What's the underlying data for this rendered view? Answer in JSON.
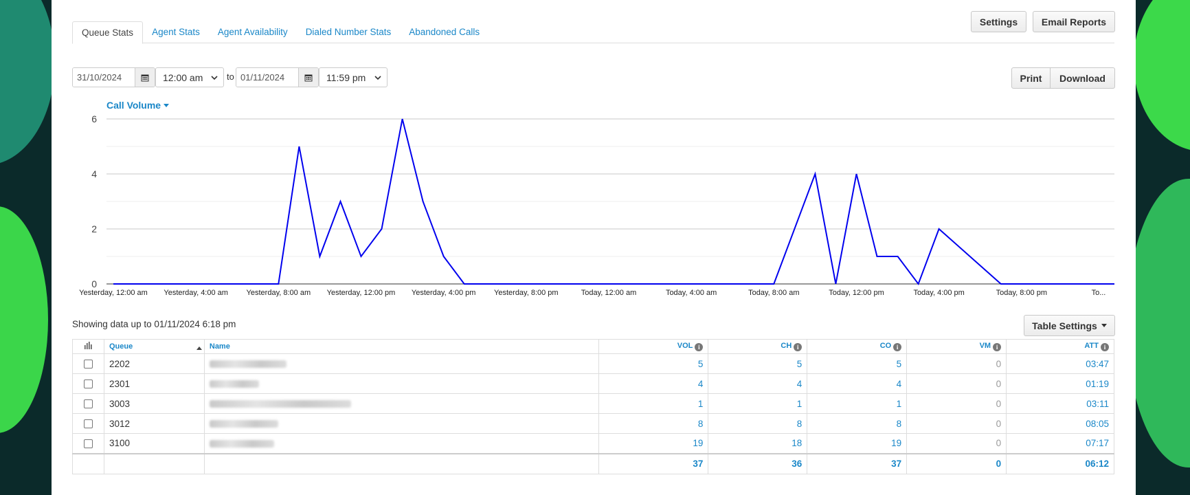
{
  "tabs": [
    {
      "label": "Queue Stats",
      "active": true
    },
    {
      "label": "Agent Stats"
    },
    {
      "label": "Agent Availability"
    },
    {
      "label": "Dialed Number Stats"
    },
    {
      "label": "Abandoned Calls"
    }
  ],
  "toolbar": {
    "settings_label": "Settings",
    "email_reports_label": "Email Reports",
    "print_label": "Print",
    "download_label": "Download",
    "table_settings_label": "Table Settings"
  },
  "filters": {
    "start_date": "31/10/2024",
    "start_time": "12:00 am",
    "to_label": "to",
    "end_date": "01/11/2024",
    "end_time": "11:59 pm"
  },
  "chart_title": "Call Volume",
  "chart_data": {
    "type": "line",
    "y_ticks": [
      0,
      2,
      4,
      6
    ],
    "ylim": [
      0,
      6
    ],
    "x_tick_labels": [
      "Yesterday, 12:00 am",
      "Yesterday, 4:00 am",
      "Yesterday, 8:00 am",
      "Yesterday, 12:00 pm",
      "Yesterday, 4:00 pm",
      "Yesterday, 8:00 pm",
      "Today, 12:00 am",
      "Today, 4:00 am",
      "Today, 8:00 am",
      "Today, 12:00 pm",
      "Today, 4:00 pm",
      "Today, 8:00 pm",
      "To..."
    ],
    "x_tick_hours": [
      0,
      4,
      8,
      12,
      16,
      20,
      24,
      28,
      32,
      36,
      40,
      44,
      48
    ],
    "xlim": [
      0,
      48.5
    ],
    "grid": true,
    "line_color": "#0000ee",
    "points": [
      [
        0,
        0
      ],
      [
        8,
        0
      ],
      [
        9,
        5
      ],
      [
        10,
        1
      ],
      [
        11,
        3
      ],
      [
        12,
        1
      ],
      [
        13,
        2
      ],
      [
        14,
        6
      ],
      [
        15,
        3
      ],
      [
        16,
        1
      ],
      [
        17,
        0
      ],
      [
        32,
        0
      ],
      [
        34,
        4
      ],
      [
        35,
        0
      ],
      [
        36,
        4
      ],
      [
        37,
        1
      ],
      [
        38,
        1
      ],
      [
        39,
        0
      ],
      [
        40,
        2
      ],
      [
        43,
        0
      ],
      [
        48.5,
        0
      ]
    ]
  },
  "showing_text": "Showing data up to 01/11/2024 6:18 pm",
  "table": {
    "columns": [
      "Queue",
      "Name",
      "VOL",
      "CH",
      "CO",
      "VM",
      "ATT"
    ],
    "rows": [
      {
        "queue": "2202",
        "vol": "5",
        "ch": "5",
        "co": "5",
        "vm": "0",
        "att": "03:47"
      },
      {
        "queue": "2301",
        "vol": "4",
        "ch": "4",
        "co": "4",
        "vm": "0",
        "att": "01:19"
      },
      {
        "queue": "3003",
        "vol": "1",
        "ch": "1",
        "co": "1",
        "vm": "0",
        "att": "03:11"
      },
      {
        "queue": "3012",
        "vol": "8",
        "ch": "8",
        "co": "8",
        "vm": "0",
        "att": "08:05"
      },
      {
        "queue": "3100",
        "vol": "19",
        "ch": "18",
        "co": "19",
        "vm": "0",
        "att": "07:17"
      }
    ],
    "totals": {
      "vol": "37",
      "ch": "36",
      "co": "37",
      "vm": "0",
      "att": "06:12"
    }
  }
}
